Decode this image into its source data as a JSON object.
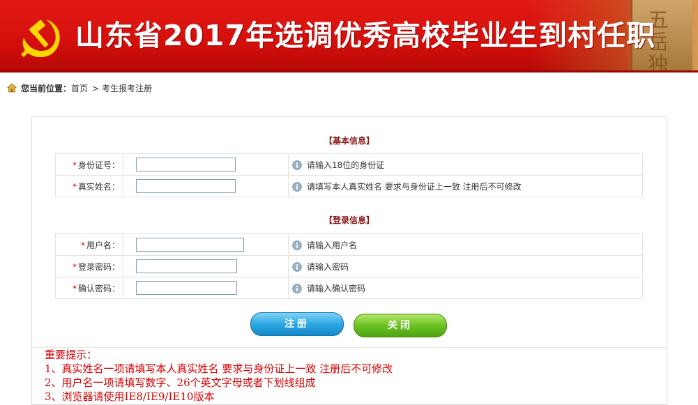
{
  "header": {
    "title": "山东省2017年选调优秀高校毕业生到村任职",
    "stone_text": [
      "五",
      "岳",
      "独"
    ]
  },
  "breadcrumb": {
    "label": "您当前位置：",
    "home": "首页",
    "separator": ">",
    "current": "考生报考注册"
  },
  "basic_section": {
    "title": "【基本信息】",
    "rows": [
      {
        "label": "身份证号：",
        "hint": "请输入18位的身份证",
        "value": ""
      },
      {
        "label": "真实姓名：",
        "hint": "请填写本人真实姓名 要求与身份证上一致 注册后不可修改",
        "value": ""
      }
    ]
  },
  "login_section": {
    "title": "【登录信息】",
    "rows": [
      {
        "label": "用户名：",
        "hint": "请输入用户名",
        "value": ""
      },
      {
        "label": "登录密码：",
        "hint": "请输入密码",
        "value": ""
      },
      {
        "label": "确认密码：",
        "hint": "请输入确认密码",
        "value": ""
      }
    ]
  },
  "required_mark": "*",
  "buttons": {
    "register": "注册",
    "close": "关闭"
  },
  "notice": {
    "title": "重要提示：",
    "items": [
      "1、真实姓名一项请填写本人真实姓名 要求与身份证上一致 注册后不可修改",
      "2、用户名一项请填写数字、26个英文字母或者下划线组成",
      "3、浏览器请使用IE8/IE9/IE10版本"
    ]
  },
  "colors": {
    "banner_red": "#d40f0b",
    "section_title": "#8b1a1a",
    "required": "#ee0000",
    "notice": "#d40000",
    "register_button": "#2ea7e3",
    "close_button": "#6cc224"
  },
  "icons": {
    "emblem": "party-emblem-icon",
    "home": "home-icon",
    "info": "info-icon"
  }
}
